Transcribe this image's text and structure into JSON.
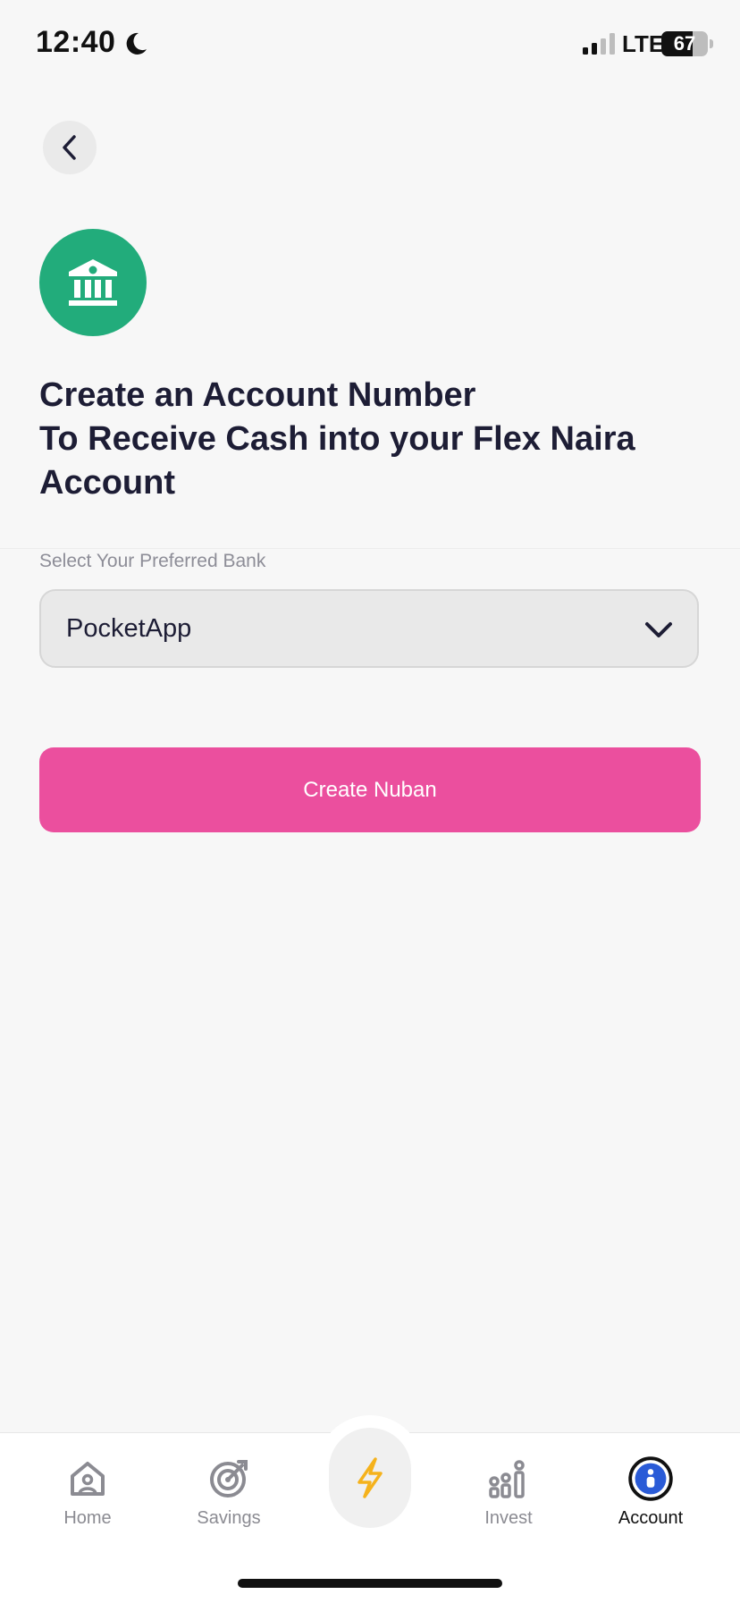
{
  "status_bar": {
    "time": "12:40",
    "network": "LTE",
    "battery_level": "67"
  },
  "header": {
    "title_line1": "Create an Account Number",
    "title_line2": "To Receive Cash into your Flex Naira",
    "title_line3": "Account"
  },
  "form": {
    "bank_label": "Select Your Preferred Bank",
    "selected_bank": "PocketApp",
    "submit_label": "Create Nuban"
  },
  "nav": {
    "items": [
      {
        "label": "Home",
        "icon": "home-icon"
      },
      {
        "label": "Savings",
        "icon": "target-icon"
      },
      {
        "label": "",
        "icon": "lightning-icon"
      },
      {
        "label": "Invest",
        "icon": "invest-icon"
      },
      {
        "label": "Account",
        "icon": "account-icon",
        "active": true
      }
    ]
  },
  "colors": {
    "background": "#f7f7f7",
    "bank_badge": "#22ac7b",
    "primary_button": "#eb4f9e",
    "text_dark": "#1d1d35",
    "text_muted": "#8d8d97",
    "active_account": "#2a5bd7",
    "lightning": "#f5b21c"
  }
}
